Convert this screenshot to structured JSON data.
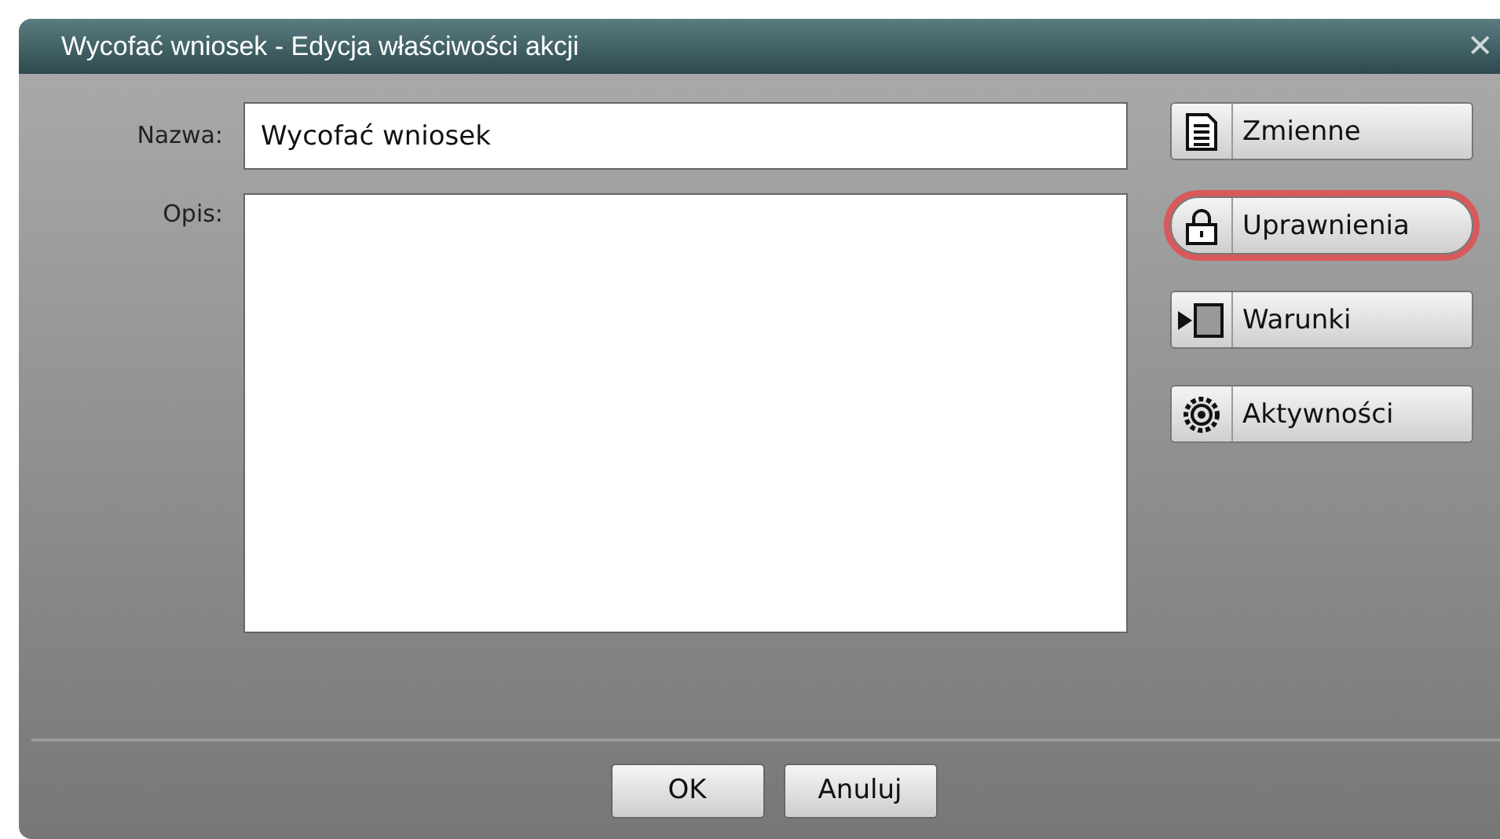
{
  "window": {
    "title": "Wycofać wniosek - Edycja właściwości akcji",
    "close": "✕"
  },
  "fields": [
    {
      "kind": "input",
      "label": "Nazwa:",
      "value": "Wycofać wniosek"
    },
    {
      "kind": "textarea",
      "label": "Opis:"
    }
  ],
  "side_buttons": [
    {
      "kind": "document",
      "label": "Zmienne",
      "highlighted": false
    },
    {
      "kind": "lock",
      "label": "Uprawnienia",
      "highlighted": true
    },
    {
      "kind": "enter",
      "label": "Warunki",
      "highlighted": false
    },
    {
      "kind": "gear",
      "label": "Aktywności",
      "highlighted": false
    }
  ],
  "buttons": [
    "OK",
    "Anuluj"
  ]
}
